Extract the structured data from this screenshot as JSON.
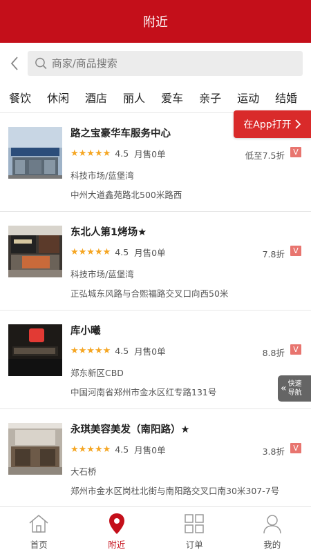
{
  "header": {
    "title": "附近"
  },
  "search": {
    "placeholder": "商家/商品搜索"
  },
  "categories": [
    "餐饮",
    "休闲",
    "酒店",
    "丽人",
    "爱车",
    "亲子",
    "运动",
    "结婚"
  ],
  "open_in_app": "在App打开",
  "quick_nav": {
    "line1": "快速",
    "line2": "导航"
  },
  "colors": {
    "brand": "#c40f1a",
    "star": "#f5a623",
    "vip": "#e8756f"
  },
  "stores": [
    {
      "name": "路之宝豪华车服务中心",
      "stars": "★★★★★",
      "score": "4.5",
      "sold": "月售0单",
      "discount": "低至7.5折",
      "vip": "V",
      "area": "科技市场/蓝堡湾",
      "address": "中州大道鑫苑路北500米路西"
    },
    {
      "name": "东北人第1烤场★",
      "stars": "★★★★★",
      "score": "4.5",
      "sold": "月售0单",
      "discount": "7.8折",
      "vip": "V",
      "area": "科技市场/蓝堡湾",
      "address": "正弘城东风路与合熙福路交叉口向西50米"
    },
    {
      "name": "库小曦",
      "stars": "★★★★★",
      "score": "4.5",
      "sold": "月售0单",
      "discount": "8.8折",
      "vip": "V",
      "area": "郑东新区CBD",
      "address": "中国河南省郑州市金水区红专路131号"
    },
    {
      "name": "永琪美容美发（南阳路）★",
      "stars": "★★★★★",
      "score": "4.5",
      "sold": "月售0单",
      "discount": "3.8折",
      "vip": "V",
      "area": "大石桥",
      "address": "郑州市金水区岗杜北街与南阳路交叉口南30米307-7号"
    }
  ],
  "tabbar": [
    {
      "label": "首页",
      "icon": "home-icon"
    },
    {
      "label": "附近",
      "icon": "location-pin-icon"
    },
    {
      "label": "订单",
      "icon": "grid-icon"
    },
    {
      "label": "我的",
      "icon": "user-icon"
    }
  ]
}
